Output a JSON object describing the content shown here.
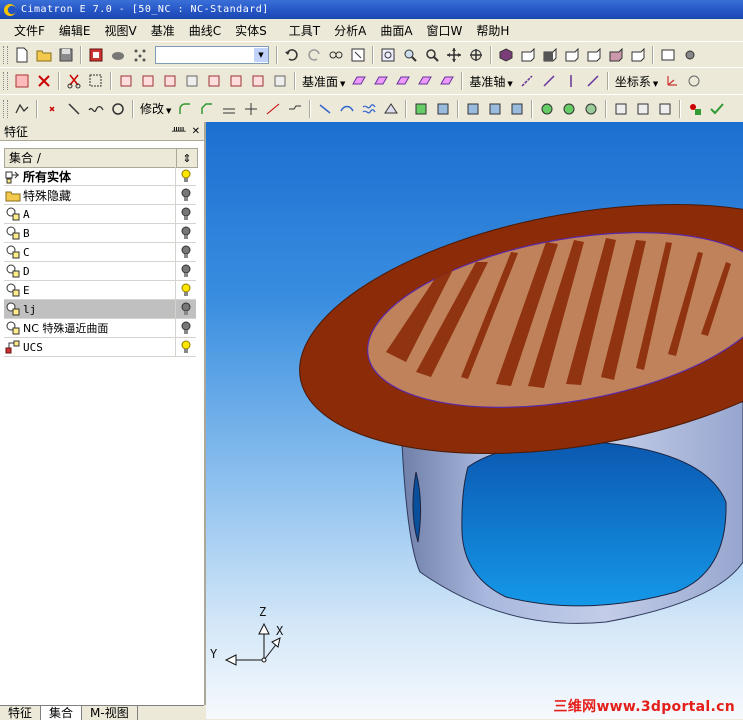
{
  "window": {
    "title": "Cimatron E 7.0 - [50_NC : NC-Standard]"
  },
  "menu": [
    {
      "label": "文件F"
    },
    {
      "label": "编辑E"
    },
    {
      "label": "视图V"
    },
    {
      "label": "基准"
    },
    {
      "label": "曲线C"
    },
    {
      "label": "实体S"
    },
    {
      "label": "工具T"
    },
    {
      "label": "分析A"
    },
    {
      "label": "曲面A"
    },
    {
      "label": "窗口W"
    },
    {
      "label": "帮助H"
    }
  ],
  "toolbar": {
    "datum_plane_label": "基准面",
    "datum_axis_label": "基准轴",
    "ucs_label": "坐标系",
    "modify_label": "修改"
  },
  "panel": {
    "title": "特征",
    "column_header": "集合 /",
    "rows": [
      {
        "label": "所有实体",
        "bold": true,
        "icon": "all-entities-icon",
        "bulb": "on"
      },
      {
        "label": "特殊隐藏",
        "icon": "folder-icon",
        "bulb": "off"
      },
      {
        "label": "A",
        "icon": "set-icon",
        "bulb": "off"
      },
      {
        "label": "B",
        "icon": "set-icon",
        "bulb": "off"
      },
      {
        "label": "C",
        "icon": "set-icon",
        "bulb": "off"
      },
      {
        "label": "D",
        "icon": "set-icon",
        "bulb": "off"
      },
      {
        "label": "E",
        "icon": "set-icon",
        "bulb": "on"
      },
      {
        "label": "lj",
        "icon": "set-icon",
        "bulb": "off",
        "selected": true
      },
      {
        "label": "NC 特殊逼近曲面",
        "icon": "set-icon",
        "bulb": "off"
      },
      {
        "label": "UCS",
        "icon": "ucs-icon",
        "bulb": "on"
      }
    ],
    "tabs": [
      "特征",
      "集合",
      "M-视图"
    ],
    "active_tab": "集合"
  },
  "viewport": {
    "axis_labels": {
      "z": "Z",
      "x": "X",
      "y": "Y"
    },
    "watermark": "三维网www.3dportal.cn"
  }
}
